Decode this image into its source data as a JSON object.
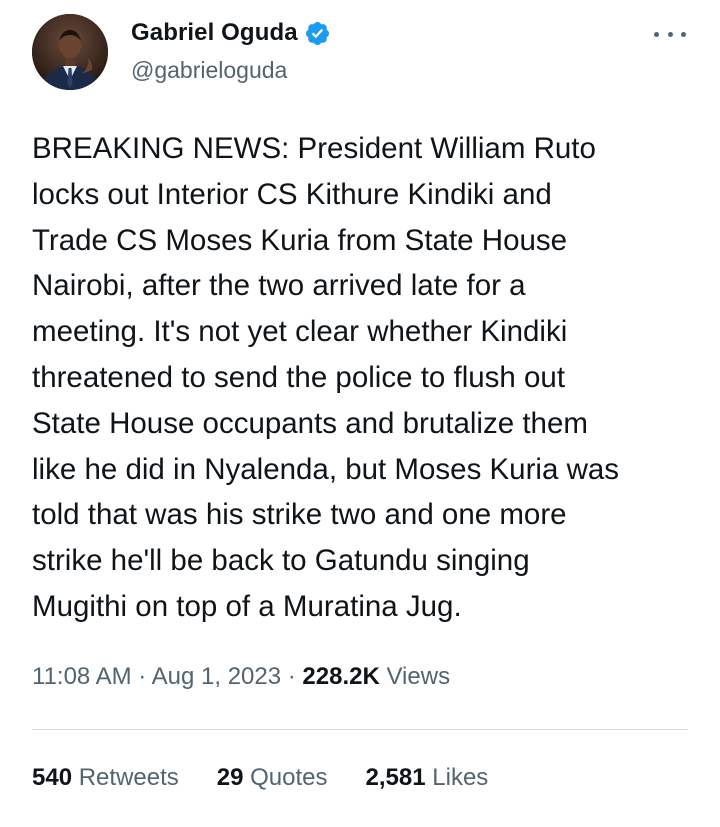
{
  "author": {
    "display_name": "Gabriel Oguda",
    "handle": "@gabrieloguda",
    "verified_icon": "verified-badge-icon",
    "verified_color": "#1d9bf0"
  },
  "tweet": {
    "text": "BREAKING NEWS: President William Ruto\nlocks out Interior CS Kithure Kindiki and\nTrade CS Moses Kuria from State House\nNairobi, after the two arrived late for a\nmeeting. It's not yet clear whether Kindiki\nthreatened to send the police to flush out\nState House occupants and brutalize them\nlike he did in Nyalenda, but Moses Kuria was\ntold that was his strike two and one more\nstrike he'll be back to Gatundu singing\nMugithi on top of a Muratina Jug."
  },
  "meta": {
    "time": "11:08 AM",
    "separator": " · ",
    "date": "Aug 1, 2023",
    "views_count": "228.2K",
    "views_label": "Views"
  },
  "stats": {
    "retweets": {
      "count": "540",
      "label": "Retweets"
    },
    "quotes": {
      "count": "29",
      "label": "Quotes"
    },
    "likes": {
      "count": "2,581",
      "label": "Likes"
    }
  },
  "colors": {
    "text_primary": "#0f1419",
    "text_secondary": "#536471",
    "divider": "#cfd9de"
  }
}
